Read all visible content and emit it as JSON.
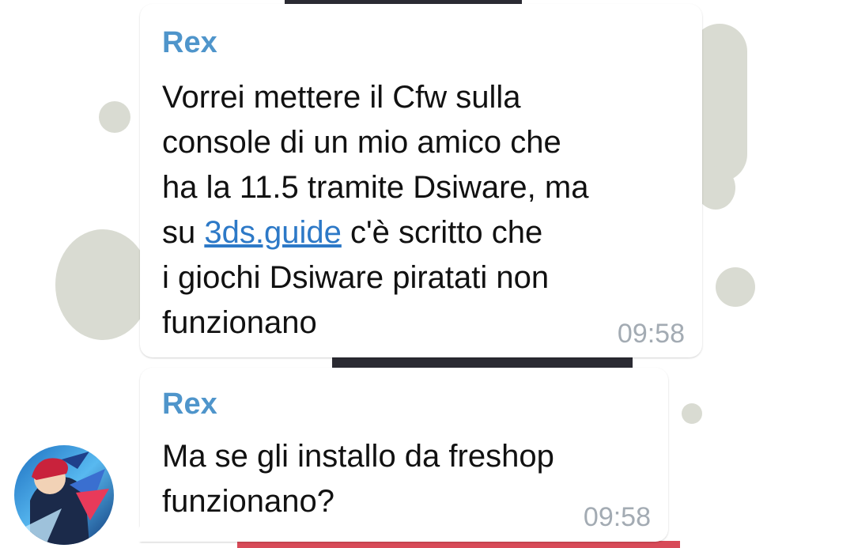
{
  "colors": {
    "sender": "#4f95cb",
    "link": "#2d79c7",
    "time": "#a3abb3",
    "text": "#111111",
    "bubble": "#ffffff"
  },
  "messages": [
    {
      "sender": "Rex",
      "text_before_link": "Vorrei mettere il Cfw sulla\nconsole di un mio amico che\nha la 11.5 tramite Dsiware, ma\nsu ",
      "link_text": "3ds.guide",
      "text_after_link": " c'è scritto che\ni giochi Dsiware piratati non\nfunzionano",
      "time": "09:58"
    },
    {
      "sender": "Rex",
      "text": "Ma se gli installo da freshop\nfunzionano?",
      "time": "09:58"
    }
  ],
  "avatar": {
    "icon": "user-avatar-anime"
  }
}
